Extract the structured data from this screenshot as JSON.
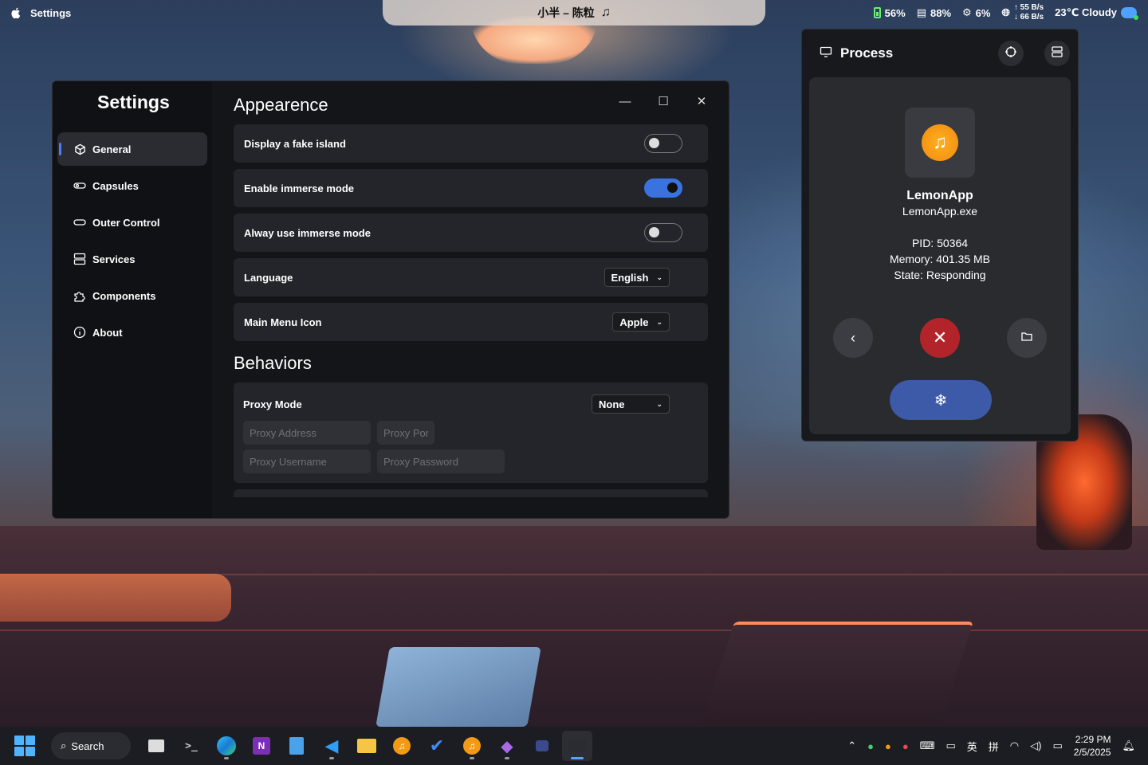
{
  "menubar": {
    "app_title": "Settings",
    "island_text": "小半 – 陈粒",
    "battery": "56%",
    "memory": "88%",
    "cpu": "6%",
    "net_up": "55 B/s",
    "net_down": "66 B/s",
    "weather": "23℃  Cloudy"
  },
  "settings": {
    "title": "Settings",
    "nav": [
      {
        "label": "General",
        "icon": "cube-icon"
      },
      {
        "label": "Capsules",
        "icon": "capsule-icon"
      },
      {
        "label": "Outer Control",
        "icon": "pill-icon"
      },
      {
        "label": "Services",
        "icon": "server-icon"
      },
      {
        "label": "Components",
        "icon": "puzzle-icon"
      },
      {
        "label": "About",
        "icon": "info-icon"
      }
    ],
    "appearance_title": "Appearence",
    "rows": {
      "fake_island": "Display a fake island",
      "immerse": "Enable immerse mode",
      "always_immerse": "Alway use immerse mode",
      "language": "Language",
      "language_value": "English",
      "menu_icon": "Main Menu Icon",
      "menu_icon_value": "Apple"
    },
    "toggles": {
      "fake_island": false,
      "immerse": true,
      "always_immerse": false
    },
    "behaviors_title": "Behaviors",
    "proxy": {
      "label": "Proxy Mode",
      "value": "None",
      "address_placeholder": "Proxy Address",
      "port_placeholder": "Proxy Port",
      "username_placeholder": "Proxy Username",
      "password_placeholder": "Proxy Password"
    }
  },
  "process": {
    "title": "Process",
    "app_name": "LemonApp",
    "exe": "LemonApp.exe",
    "pid": "PID: 50364",
    "memory": "Memory: 401.35 MB",
    "state": "State: Responding"
  },
  "taskbar": {
    "search_label": "Search",
    "tray_ime1": "英",
    "tray_ime2": "拼",
    "time": "2:29 PM",
    "date": "2/5/2025"
  },
  "colors": {
    "accent": "#3a73e0",
    "kill": "#b3242a",
    "freeze": "#3d5aa8"
  }
}
